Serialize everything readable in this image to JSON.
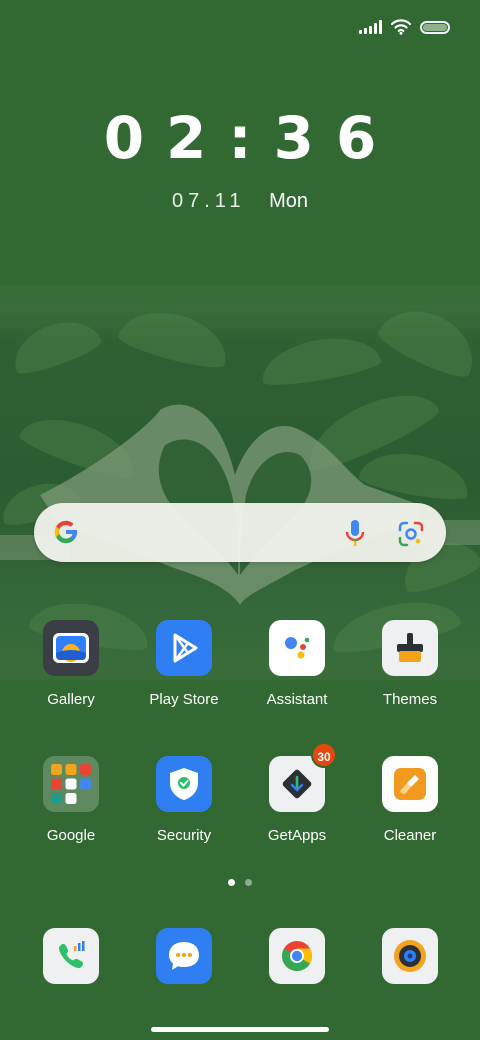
{
  "status_bar": {
    "icons": [
      "signal-icon",
      "wifi-icon",
      "battery-icon"
    ]
  },
  "clock": {
    "time": "02:36",
    "date": "07.11",
    "day": "Mon"
  },
  "search_widget": {
    "icons": [
      "google-g-icon",
      "mic-icon",
      "google-lens-icon"
    ]
  },
  "apps": [
    {
      "label": "Gallery",
      "icon": "gallery-icon"
    },
    {
      "label": "Play Store",
      "icon": "play-store-icon"
    },
    {
      "label": "Assistant",
      "icon": "assistant-icon"
    },
    {
      "label": "Themes",
      "icon": "themes-icon"
    },
    {
      "label": "Google",
      "icon": "google-folder-icon"
    },
    {
      "label": "Security",
      "icon": "security-icon"
    },
    {
      "label": "GetApps",
      "icon": "getapps-icon",
      "badge": "30"
    },
    {
      "label": "Cleaner",
      "icon": "cleaner-icon"
    }
  ],
  "page_indicator": {
    "pages": 2,
    "active": 1
  },
  "dock": [
    {
      "icon": "phone-icon"
    },
    {
      "icon": "messages-icon"
    },
    {
      "icon": "chrome-icon"
    },
    {
      "icon": "camera-icon"
    }
  ],
  "colors": {
    "background": "#326933",
    "badge": "#e8480f",
    "accent_blue": "#2f7ff2"
  }
}
